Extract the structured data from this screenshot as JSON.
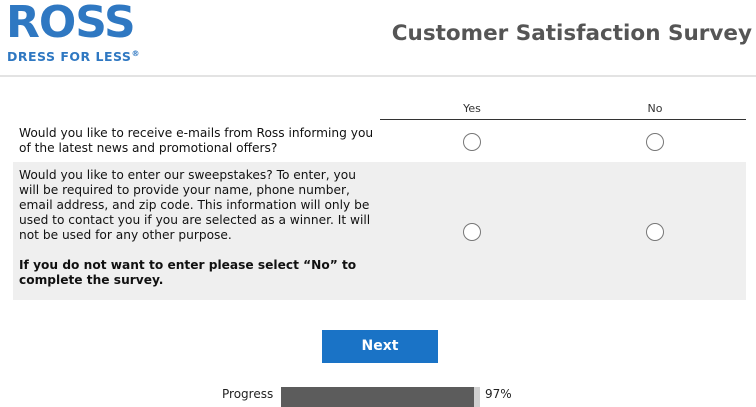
{
  "header": {
    "logo_word": "ROSS",
    "logo_tagline": "DRESS FOR LESS",
    "logo_reg": "®",
    "title": "Customer Satisfaction Survey"
  },
  "table": {
    "columns": [
      "Yes",
      "No"
    ],
    "questions": [
      {
        "text": "Would you like to receive e-mails from Ross informing you of the latest news and promotional offers?",
        "note": ""
      },
      {
        "text": "Would you like to enter our sweepstakes? To enter, you will be required to provide your name, phone number, email address, and zip code. This information will only be used to contact you if you are selected as a winner. It will not be used for any other purpose.",
        "note": "If you do not want to enter please select “No” to complete the survey."
      }
    ]
  },
  "next_label": "Next",
  "progress": {
    "label": "Progress",
    "percent_text": "97%",
    "value": 0.97
  },
  "colors": {
    "brand_blue": "#2f78c2",
    "button_blue": "#1a73c6",
    "progress_fill": "#5c5c5c"
  }
}
